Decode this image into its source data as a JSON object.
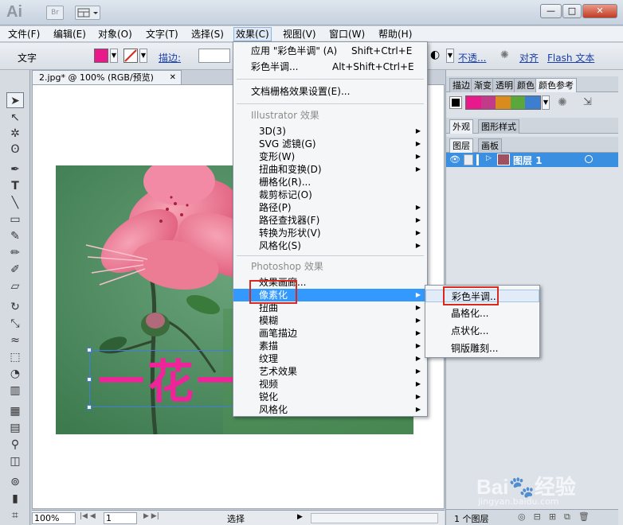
{
  "app": {
    "logo": "Ai",
    "bridge_label": "Br"
  },
  "window_buttons": {
    "minimize": "—",
    "maximize": "□",
    "close": "✕"
  },
  "menubar": {
    "items": [
      "文件(F)",
      "编辑(E)",
      "对象(O)",
      "文字(T)",
      "选择(S)",
      "效果(C)",
      "视图(V)",
      "窗口(W)",
      "帮助(H)"
    ]
  },
  "controlbar": {
    "mode_label": "文字",
    "stroke_label": "描边:",
    "opacity_label": "不透...",
    "align_label": "对齐",
    "flash_text_label": "Flash 文本",
    "fill_color": "#e8198b"
  },
  "document": {
    "tab_title": "2.jpg* @ 100% (RGB/预览)",
    "selection_text": "一花一",
    "text_color": "#f0239a"
  },
  "statusbar": {
    "zoom": "100%",
    "page": "1",
    "tool_label": "选择"
  },
  "effect_menu": {
    "apply_last": {
      "label": "应用 \"彩色半调\" (A)",
      "shortcut": "Shift+Ctrl+E"
    },
    "last_effect": {
      "label": "彩色半调...",
      "shortcut": "Alt+Shift+Ctrl+E"
    },
    "doc_raster_settings": "文档栅格效果设置(E)...",
    "illustrator_header": "Illustrator 效果",
    "illustrator_items": [
      "3D(3)",
      "SVG 滤镜(G)",
      "变形(W)",
      "扭曲和变换(D)",
      "栅格化(R)...",
      "裁剪标记(O)",
      "路径(P)",
      "路径查找器(F)",
      "转换为形状(V)",
      "风格化(S)"
    ],
    "photoshop_header": "Photoshop 效果",
    "photoshop_items": [
      "效果画廊...",
      "像素化",
      "扭曲",
      "模糊",
      "画笔描边",
      "素描",
      "纹理",
      "艺术效果",
      "视频",
      "锐化",
      "风格化"
    ]
  },
  "pixelate_submenu": {
    "items": [
      "彩色半调...",
      "晶格化...",
      "点状化...",
      "铜版雕刻..."
    ]
  },
  "panels": {
    "top_tabs": [
      "描边",
      "渐变",
      "透明",
      "颜色",
      "颜色参考"
    ],
    "appearance_tabs": [
      "外观",
      "图形样式"
    ],
    "layers_tabs": [
      "图层",
      "画板"
    ],
    "layer_name": "图层 1",
    "layer_count": "1 个图层",
    "harmony_colors": [
      "#e8198b",
      "#c23a8a",
      "#d98b1e",
      "#5aa83c",
      "#3c7ed0"
    ]
  },
  "watermark": {
    "brand": "Bai",
    "brand2": "经验",
    "url": "jingyan.baidu.com"
  }
}
